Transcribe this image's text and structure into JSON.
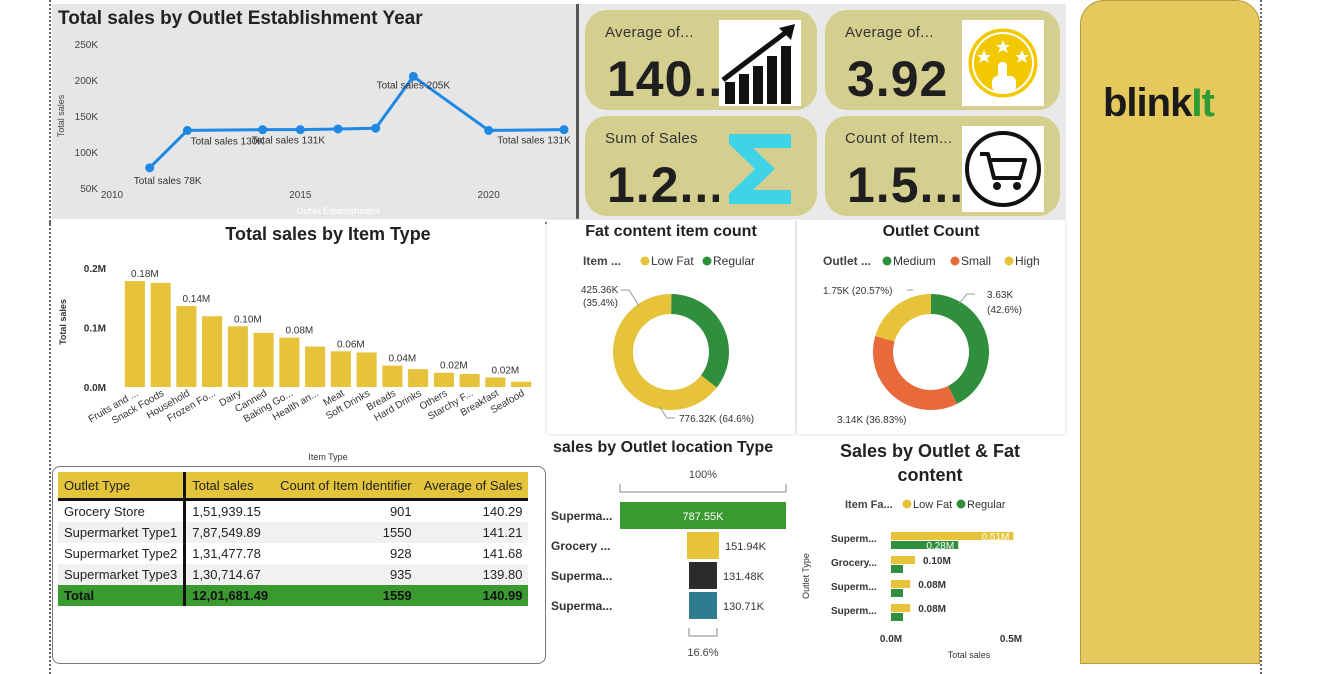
{
  "colors": {
    "yellow": "#e6c33a",
    "green": "#3a9a2f",
    "darkgreen": "#2f8f3c",
    "orange": "#e8693a",
    "blue": "#1e88e5",
    "kpi_bg": "#d5cf8f",
    "black": "#2b2b2b",
    "teal": "#2e7d8f"
  },
  "kpis": [
    {
      "label": "Average of...",
      "value": "140..",
      "icon": "growth-chart-icon"
    },
    {
      "label": "Average of...",
      "value": "3.92",
      "icon": "star-rating-icon"
    },
    {
      "label": "Sum of Sales",
      "value": "1.2...",
      "icon": "sigma-icon"
    },
    {
      "label": "Count of Item...",
      "value": "1.5...",
      "icon": "shopping-cart-icon"
    }
  ],
  "brand": {
    "name_black": "blink",
    "name_green": "It"
  },
  "table": {
    "headers": [
      "Outlet Type",
      "Total sales",
      "Count of Item Identifier",
      "Average of Sales"
    ],
    "rows": [
      [
        "Grocery Store",
        "1,51,939.15",
        "901",
        "140.29"
      ],
      [
        "Supermarket Type1",
        "7,87,549.89",
        "1550",
        "141.21"
      ],
      [
        "Supermarket Type2",
        "1,31,477.78",
        "928",
        "141.68"
      ],
      [
        "Supermarket Type3",
        "1,30,714.67",
        "935",
        "139.80"
      ]
    ],
    "total": [
      "Total",
      "12,01,681.49",
      "1559",
      "140.99"
    ]
  },
  "chart_data": [
    {
      "type": "line",
      "title": "Total sales by Outlet Establishment Year",
      "xlabel": "Outlet Establishment",
      "ylabel": "Total sales",
      "x": [
        2011,
        2012,
        2014,
        2015,
        2016,
        2017,
        2018,
        2020,
        2022
      ],
      "values": [
        78,
        130,
        131,
        131,
        132,
        133,
        205,
        130,
        131
      ],
      "ylim": [
        50,
        250
      ],
      "yticks": [
        "50K",
        "100K",
        "150K",
        "200K",
        "250K"
      ],
      "xticks": [
        2010,
        2015,
        2020
      ],
      "annotations": [
        {
          "x": 2011,
          "text": "Total sales 78K"
        },
        {
          "x": 2012,
          "text": "Total sales 130K"
        },
        {
          "x": 2015,
          "text": "Total sales 131K"
        },
        {
          "x": 2018,
          "text": "Total sales 205K"
        },
        {
          "x": 2022,
          "text": "Total sales 131K"
        }
      ]
    },
    {
      "type": "bar",
      "title": "Total sales by Item Type",
      "xlabel": "Item Type",
      "ylabel": "Total sales",
      "categories": [
        "Fruits and ...",
        "Snack Foods",
        "Household",
        "Frozen Fo...",
        "Dairy",
        "Canned",
        "Baking Go...",
        "Health an...",
        "Meat",
        "Soft Drinks",
        "Breads",
        "Hard Drinks",
        "Others",
        "Starchy F...",
        "Breakfast",
        "Seafood"
      ],
      "values": [
        0.178,
        0.175,
        0.136,
        0.119,
        0.102,
        0.091,
        0.083,
        0.068,
        0.06,
        0.058,
        0.036,
        0.03,
        0.024,
        0.022,
        0.016,
        0.009
      ],
      "labels": [
        "0.18M",
        "",
        "0.14M",
        "",
        "0.10M",
        "",
        "0.08M",
        "",
        "0.06M",
        "",
        "0.04M",
        "",
        "0.02M",
        "",
        "0.02M",
        ""
      ],
      "ylim": [
        0,
        0.2
      ],
      "yticks": [
        "0.0M",
        "0.1M",
        "0.2M"
      ]
    },
    {
      "type": "pie",
      "title": "Fat content item count",
      "legend_title": "Item ...",
      "series": [
        {
          "name": "Low Fat",
          "value": 776.32,
          "label": "776.32K (64.6%)"
        },
        {
          "name": "Regular",
          "value": 425.36,
          "label": "425.36K (35.4%)"
        }
      ]
    },
    {
      "type": "pie",
      "title": "Outlet Count",
      "legend_title": "Outlet ...",
      "series": [
        {
          "name": "Medium",
          "value": 3.63,
          "label_a": "3.63K",
          "label_b": "(42.6%)"
        },
        {
          "name": "Small",
          "value": 3.14,
          "label": "3.14K (36.83%)"
        },
        {
          "name": "High",
          "value": 1.75,
          "label": "1.75K (20.57%)"
        }
      ]
    },
    {
      "type": "bar",
      "title": "sales by Outlet location Type",
      "categories": [
        "Superma...",
        "Grocery ...",
        "Superma...",
        "Superma..."
      ],
      "values": [
        787.55,
        151.94,
        131.48,
        130.71
      ],
      "labels": [
        "787.55K",
        "151.94K",
        "131.48K",
        "130.71K"
      ],
      "top_pct": "100%",
      "bottom_pct": "16.6%"
    },
    {
      "type": "bar",
      "title": "Sales by Outlet & Fat content",
      "legend_title": "Item Fa...",
      "xlabel": "Total sales",
      "ylabel": "Outlet Type",
      "categories": [
        "Superm...",
        "Grocery...",
        "Superm...",
        "Superm..."
      ],
      "series": [
        {
          "name": "Low Fat",
          "values": [
            0.51,
            0.1,
            0.08,
            0.08
          ],
          "labels": [
            "0.51M",
            "0.10M",
            "0.08M",
            "0.08M"
          ]
        },
        {
          "name": "Regular",
          "values": [
            0.28,
            0.05,
            0.05,
            0.05
          ],
          "labels": [
            "0.28M",
            "",
            "",
            ""
          ]
        }
      ],
      "xticks": [
        "0.0M",
        "0.5M"
      ]
    }
  ]
}
